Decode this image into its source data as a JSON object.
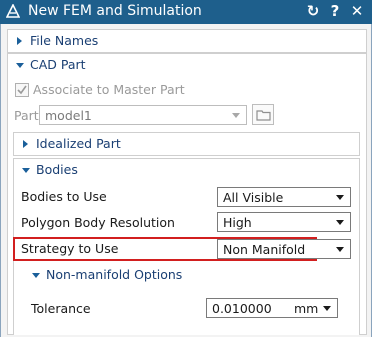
{
  "window": {
    "title": "New FEM and Simulation"
  },
  "sections": {
    "file_names": {
      "label": "File Names"
    },
    "cad_part": {
      "label": "CAD Part",
      "associate_label": "Associate to Master Part",
      "part_label": "Part",
      "part_value": "model1"
    },
    "idealized_part": {
      "label": "Idealized Part"
    },
    "bodies": {
      "label": "Bodies",
      "bodies_to_use_label": "Bodies to Use",
      "bodies_to_use_value": "All Visible",
      "polygon_res_label": "Polygon Body Resolution",
      "polygon_res_value": "High",
      "strategy_label": "Strategy to Use",
      "strategy_value": "Non Manifold",
      "nonmanifold": {
        "label": "Non-manifold Options",
        "tolerance_label": "Tolerance",
        "tolerance_value": "0.010000",
        "tolerance_unit": "mm"
      }
    }
  },
  "colors": {
    "titlebar": "#1e5f8c",
    "highlight": "#d21f1f",
    "section_header": "#1a3f73"
  }
}
